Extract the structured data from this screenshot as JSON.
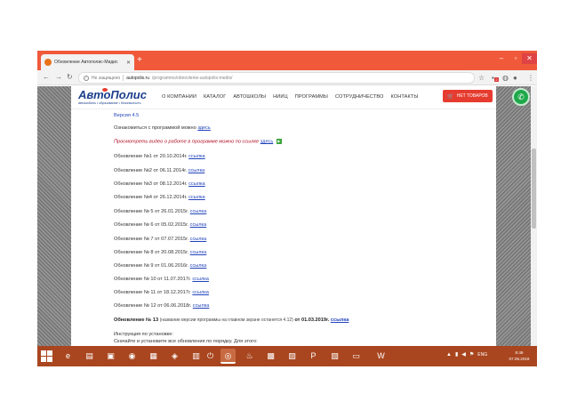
{
  "browser": {
    "tab_title": "Обновление Автополис-Мидис",
    "tab_close": "✕",
    "new_tab": "+",
    "window_min": "–",
    "window_max": "▫",
    "window_close": "✕",
    "security_label": "Не защищено",
    "url_domain": "autopolis.ru",
    "url_path": "/programms/obnovlenie-autopolis-medis/",
    "icons": [
      "back-arrow-icon",
      "forward-arrow-icon",
      "reload-icon",
      "info-icon",
      "star-icon",
      "extension-icon",
      "account-icon",
      "menu-icon"
    ],
    "ext_badge": "2"
  },
  "site": {
    "logo_text": "АвтоПолис",
    "logo_tagline": "автомобиль • образование • безопасность",
    "nav": [
      "О КОМПАНИИ",
      "КАТАЛОГ",
      "АВТОШКОЛЫ",
      "НИИЦ",
      "ПРОГРАММЫ",
      "СОТРУДНИЧЕСТВО",
      "КОНТАКТЫ"
    ],
    "cart_label": "НЕТ ТОВАРОВ",
    "accent": "#e63c2f",
    "brand": "#1c3f8c",
    "phone_color": "#1fa84a"
  },
  "content": {
    "version": "Версия 4.5",
    "demo_prefix": "Ознакомиться с программой можно",
    "demo_link": "здесь",
    "video_prefix": "Просмотреть видео о работе в программе можно по ссылке",
    "video_link": "здесь",
    "updates": [
      {
        "label": "Обновление №1 от 20.10.2014г.",
        "link": "ссылка"
      },
      {
        "label": "Обновление №2 от 06.11.2014г.",
        "link": "ссылка"
      },
      {
        "label": "Обновление №3 от 08.12.2014г.",
        "link": "ссылка"
      },
      {
        "label": "Обновление №4 от 26.12.2014г.",
        "link": "ссылка"
      },
      {
        "label": "Обновление № 5 от 26.01.2015г.",
        "link": "ссылка"
      },
      {
        "label": "Обновление № 6 от 05.02.2015г.",
        "link": "ссылка"
      },
      {
        "label": "Обновление № 7 от 07.07.2015г.",
        "link": "ссылка"
      },
      {
        "label": "Обновление № 8 от 20.08.2015г.",
        "link": "ссылка"
      },
      {
        "label": "Обновление № 9 от 01.06.2016г.",
        "link": "ссылка"
      },
      {
        "label": "Обновление № 10 от 11.07.2017г.",
        "link": "ссылка"
      },
      {
        "label": "Обновление № 11 от 18.12.2017г.",
        "link": "ссылка"
      },
      {
        "label": "Обновление № 12 от 06.06.2018г.",
        "link": "ссылка"
      }
    ],
    "update13_label": "Обновление № 13",
    "update13_note": "(название версии программы на главном экране останется 4.12)",
    "update13_date": "от 01.03.2019г.",
    "update13_link": "ссылка",
    "install_heading": "Инструкция по установке:",
    "install_text": "Скачайте и установите все обновления по порядку. Для этого:"
  },
  "taskbar": {
    "apps": [
      "explorer-icon",
      "ie-icon",
      "folder-icon",
      "player-icon",
      "camera-icon",
      "media-icon",
      "app-icon",
      "power-icon",
      "chrome-icon",
      "java-icon",
      "excel-icon",
      "photo-icon",
      "powerpoint-icon",
      "network-icon",
      "display-icon",
      "word-icon"
    ],
    "lang": "ENG",
    "time": "8:49",
    "date": "07.05.2019"
  }
}
